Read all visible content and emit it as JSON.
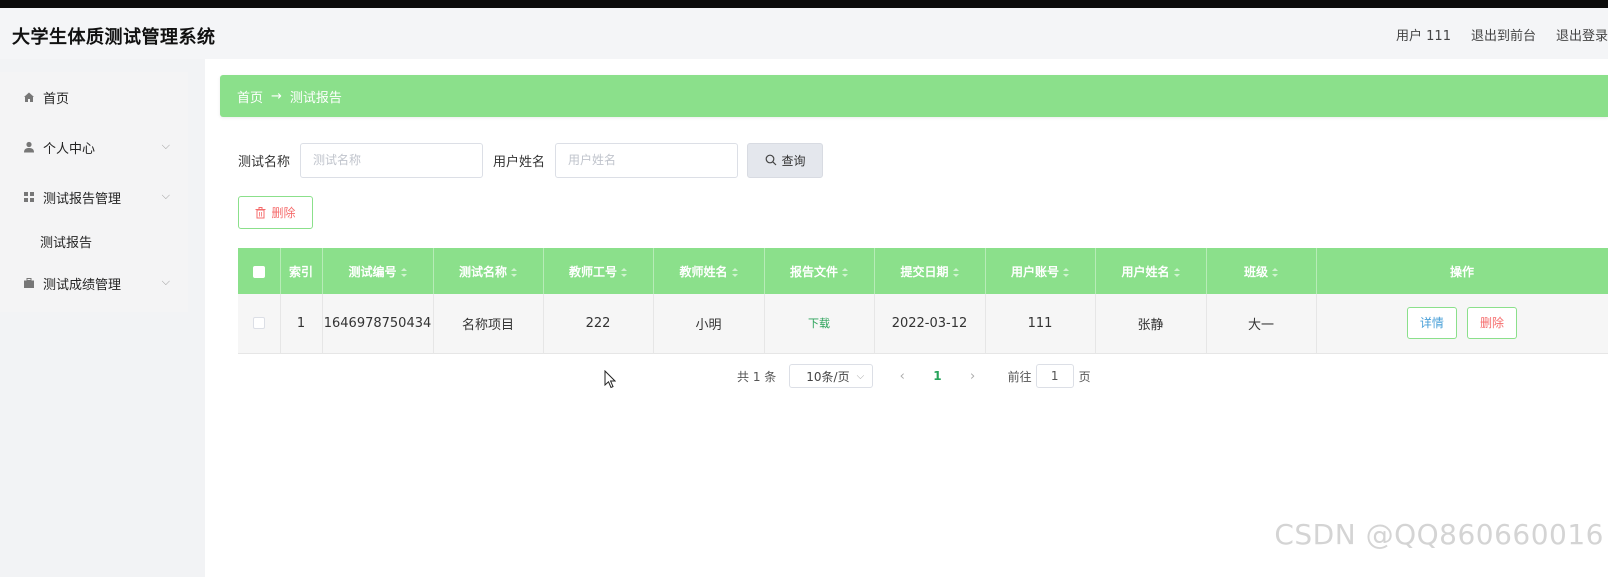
{
  "header": {
    "title": "大学生体质测试管理系统",
    "user": "用户 111",
    "to_front": "退出到前台",
    "logout": "退出登录"
  },
  "sidebar": {
    "items": [
      {
        "label": "首页",
        "icon": "home-icon"
      },
      {
        "label": "个人中心",
        "icon": "user-icon"
      },
      {
        "label": "测试报告管理",
        "icon": "grid-icon"
      },
      {
        "label": "测试报告",
        "icon": ""
      },
      {
        "label": "测试成绩管理",
        "icon": "briefcase-icon"
      }
    ]
  },
  "breadcrumb": {
    "home": "首页",
    "separator": "→",
    "current": "测试报告"
  },
  "search": {
    "test_name_label": "测试名称",
    "test_name_placeholder": "测试名称",
    "user_name_label": "用户姓名",
    "user_name_placeholder": "用户姓名",
    "query_label": "查询"
  },
  "toolbar": {
    "delete_label": "删除"
  },
  "table": {
    "columns": [
      "索引",
      "测试编号",
      "测试名称",
      "教师工号",
      "教师姓名",
      "报告文件",
      "提交日期",
      "用户账号",
      "用户姓名",
      "班级",
      "操作"
    ],
    "rows": [
      {
        "index": "1",
        "test_no": "1646978750434",
        "test_name": "名称项目",
        "teacher_id": "222",
        "teacher_name": "小明",
        "report_file": "下载",
        "submit_date": "2022-03-12",
        "user_account": "111",
        "user_name": "张静",
        "class": "大一",
        "detail_label": "详情",
        "delete_label": "删除"
      }
    ]
  },
  "pagination": {
    "total": "共 1 条",
    "page_size": "10条/页",
    "current_page": "1",
    "goto_prefix": "前往",
    "goto_value": "1",
    "goto_suffix": "页"
  },
  "watermark": "CSDN @QQ860660016",
  "colors": {
    "accent": "#8be08b",
    "danger": "#f56c6c",
    "link": "#4aa0d8"
  }
}
